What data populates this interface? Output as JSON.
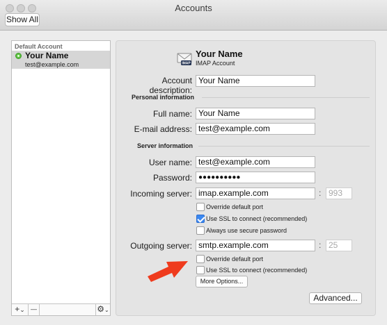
{
  "window": {
    "title": "Accounts",
    "show_all_label": "Show All"
  },
  "sidebar": {
    "section_label": "Default Account",
    "account": {
      "name": "Your Name",
      "email": "test@example.com",
      "status_icon": "status-online-icon"
    },
    "add_label": "+",
    "add_menu_glyph": "⌄",
    "remove_label": "—",
    "gear_label": "⚙",
    "gear_menu_glyph": "⌄"
  },
  "header": {
    "icon": "mail-imap-icon",
    "icon_badge": "IMAP",
    "name": "Your Name",
    "type": "IMAP Account"
  },
  "form": {
    "account_description": {
      "label": "Account description:",
      "value": "Your Name"
    },
    "personal_section": "Personal information",
    "full_name": {
      "label": "Full name:",
      "value": "Your Name"
    },
    "email": {
      "label": "E-mail address:",
      "value": "test@example.com"
    },
    "server_section": "Server information",
    "user_name": {
      "label": "User name:",
      "value": "test@example.com"
    },
    "password": {
      "label": "Password:",
      "value": "●●●●●●●●●●"
    },
    "incoming": {
      "label": "Incoming server:",
      "value": "imap.example.com",
      "port_separator": ":",
      "port": "993",
      "override_port": {
        "label": "Override default port",
        "checked": false
      },
      "use_ssl": {
        "label": "Use SSL to connect (recommended)",
        "checked": true
      },
      "secure_password": {
        "label": "Always use secure password",
        "checked": false
      }
    },
    "outgoing": {
      "label": "Outgoing server:",
      "value": "smtp.example.com",
      "port_separator": ":",
      "port": "25",
      "override_port": {
        "label": "Override default port",
        "checked": false
      },
      "use_ssl": {
        "label": "Use SSL to connect (recommended)",
        "checked": false
      },
      "more_options_label": "More Options..."
    },
    "advanced_label": "Advanced..."
  },
  "colors": {
    "accent": "#3b88f0",
    "annotation_arrow": "#ef3b1d",
    "status_online": "#5ec341"
  }
}
